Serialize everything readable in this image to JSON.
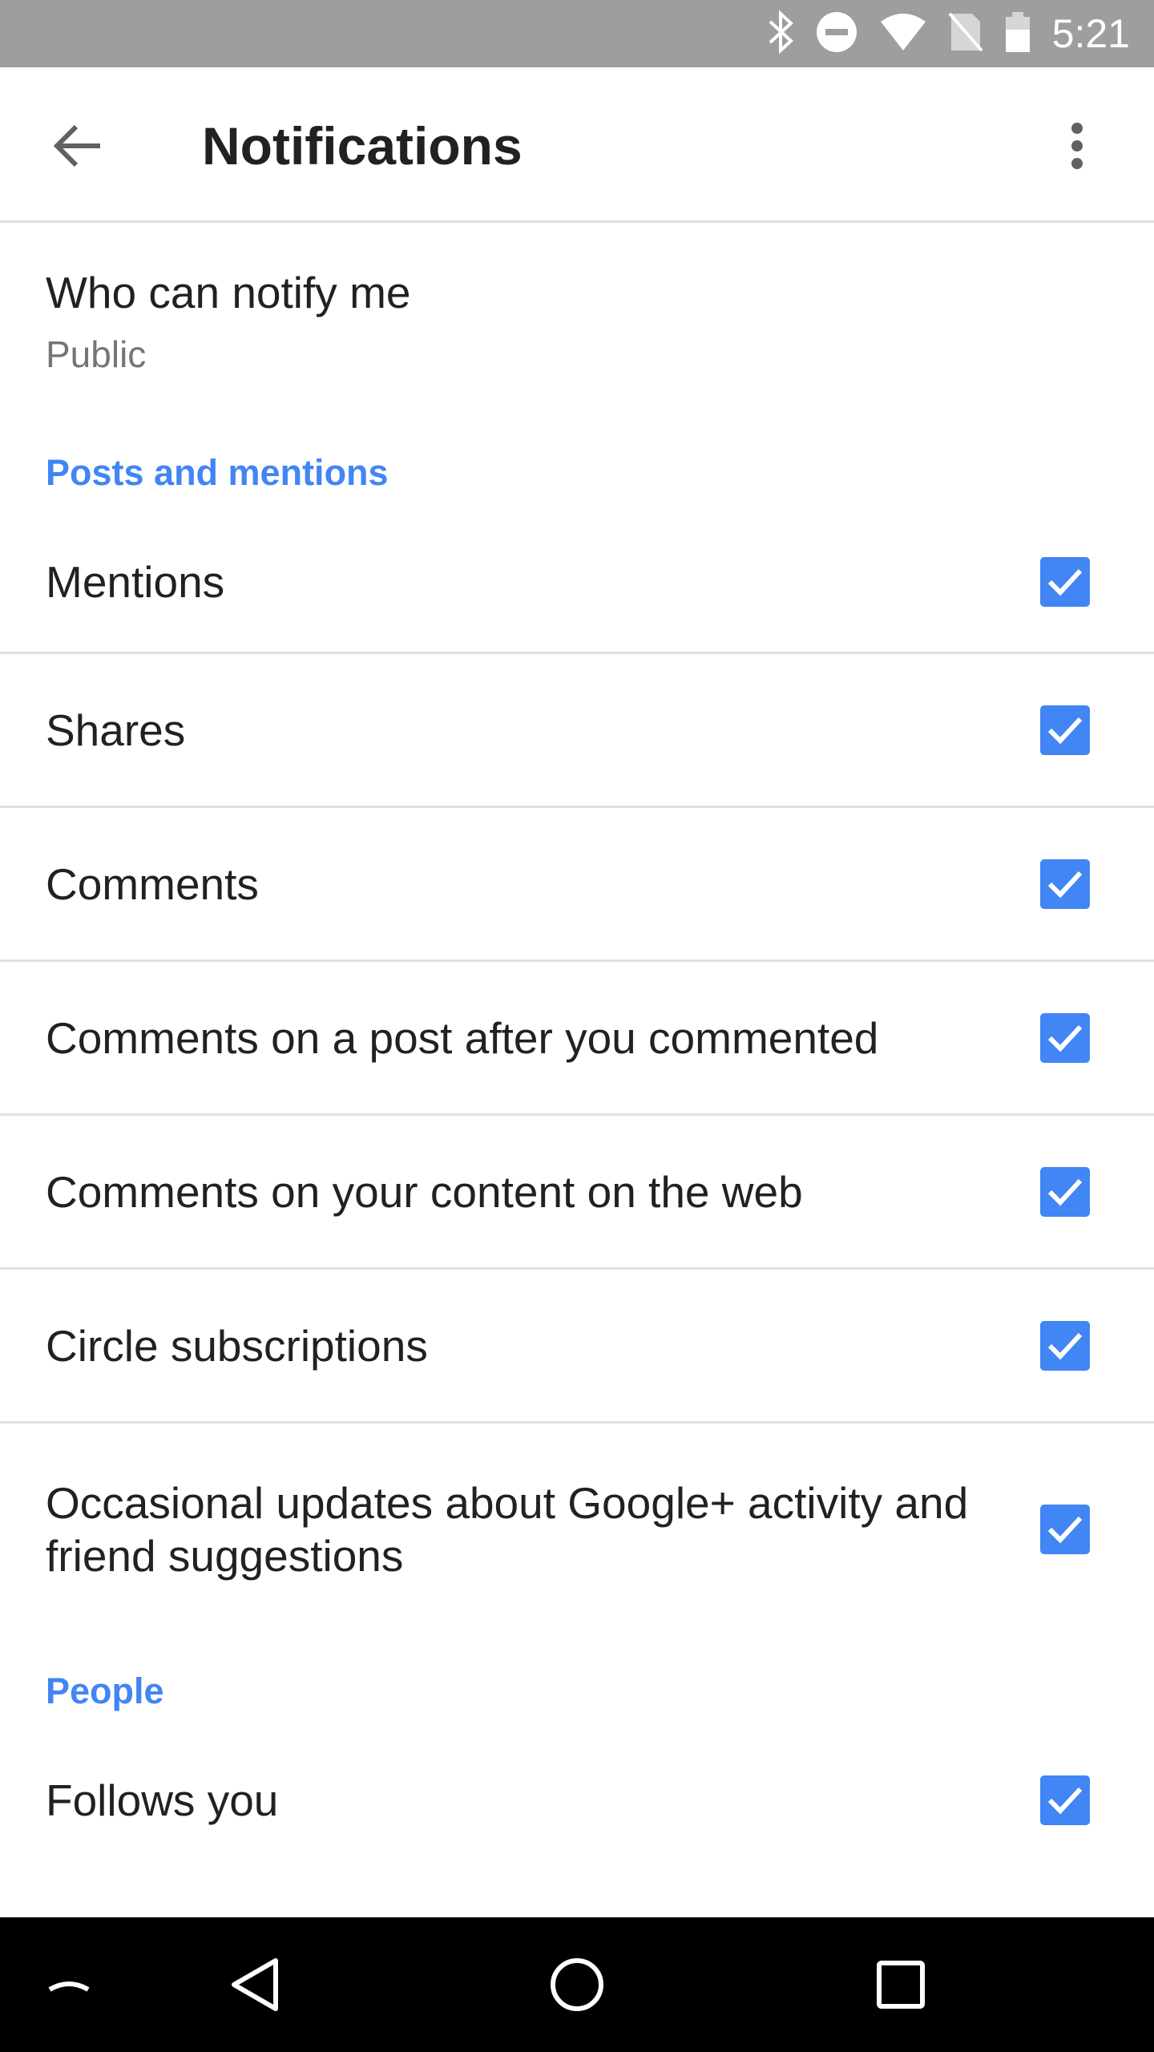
{
  "status_bar": {
    "time": "5:21",
    "icons": [
      "bluetooth-icon",
      "do-not-disturb-icon",
      "wifi-icon",
      "no-sim-icon",
      "battery-icon"
    ]
  },
  "app_bar": {
    "title": "Notifications",
    "back_icon": "arrow-back-icon",
    "overflow_icon": "more-vert-icon"
  },
  "who_can_notify": {
    "title": "Who can notify me",
    "value": "Public"
  },
  "sections": [
    {
      "header": "Posts and mentions",
      "items": [
        {
          "label": "Mentions",
          "checked": true
        },
        {
          "label": "Shares",
          "checked": true
        },
        {
          "label": "Comments",
          "checked": true
        },
        {
          "label": "Comments on a post after you commented",
          "checked": true
        },
        {
          "label": "Comments on your content on the web",
          "checked": true
        },
        {
          "label": "Circle subscriptions",
          "checked": true
        },
        {
          "label": "Occasional updates about Google+ activity and friend suggestions",
          "checked": true
        }
      ]
    },
    {
      "header": "People",
      "items": [
        {
          "label": "Follows you",
          "checked": true
        }
      ]
    }
  ],
  "nav_bar": {
    "icons": [
      "expand-icon",
      "back-triangle-icon",
      "home-circle-icon",
      "recents-square-icon"
    ]
  },
  "colors": {
    "accent": "#4285f4",
    "status_bar": "#9e9e9e",
    "divider": "#e0e0e0",
    "nav_bar": "#000000"
  }
}
